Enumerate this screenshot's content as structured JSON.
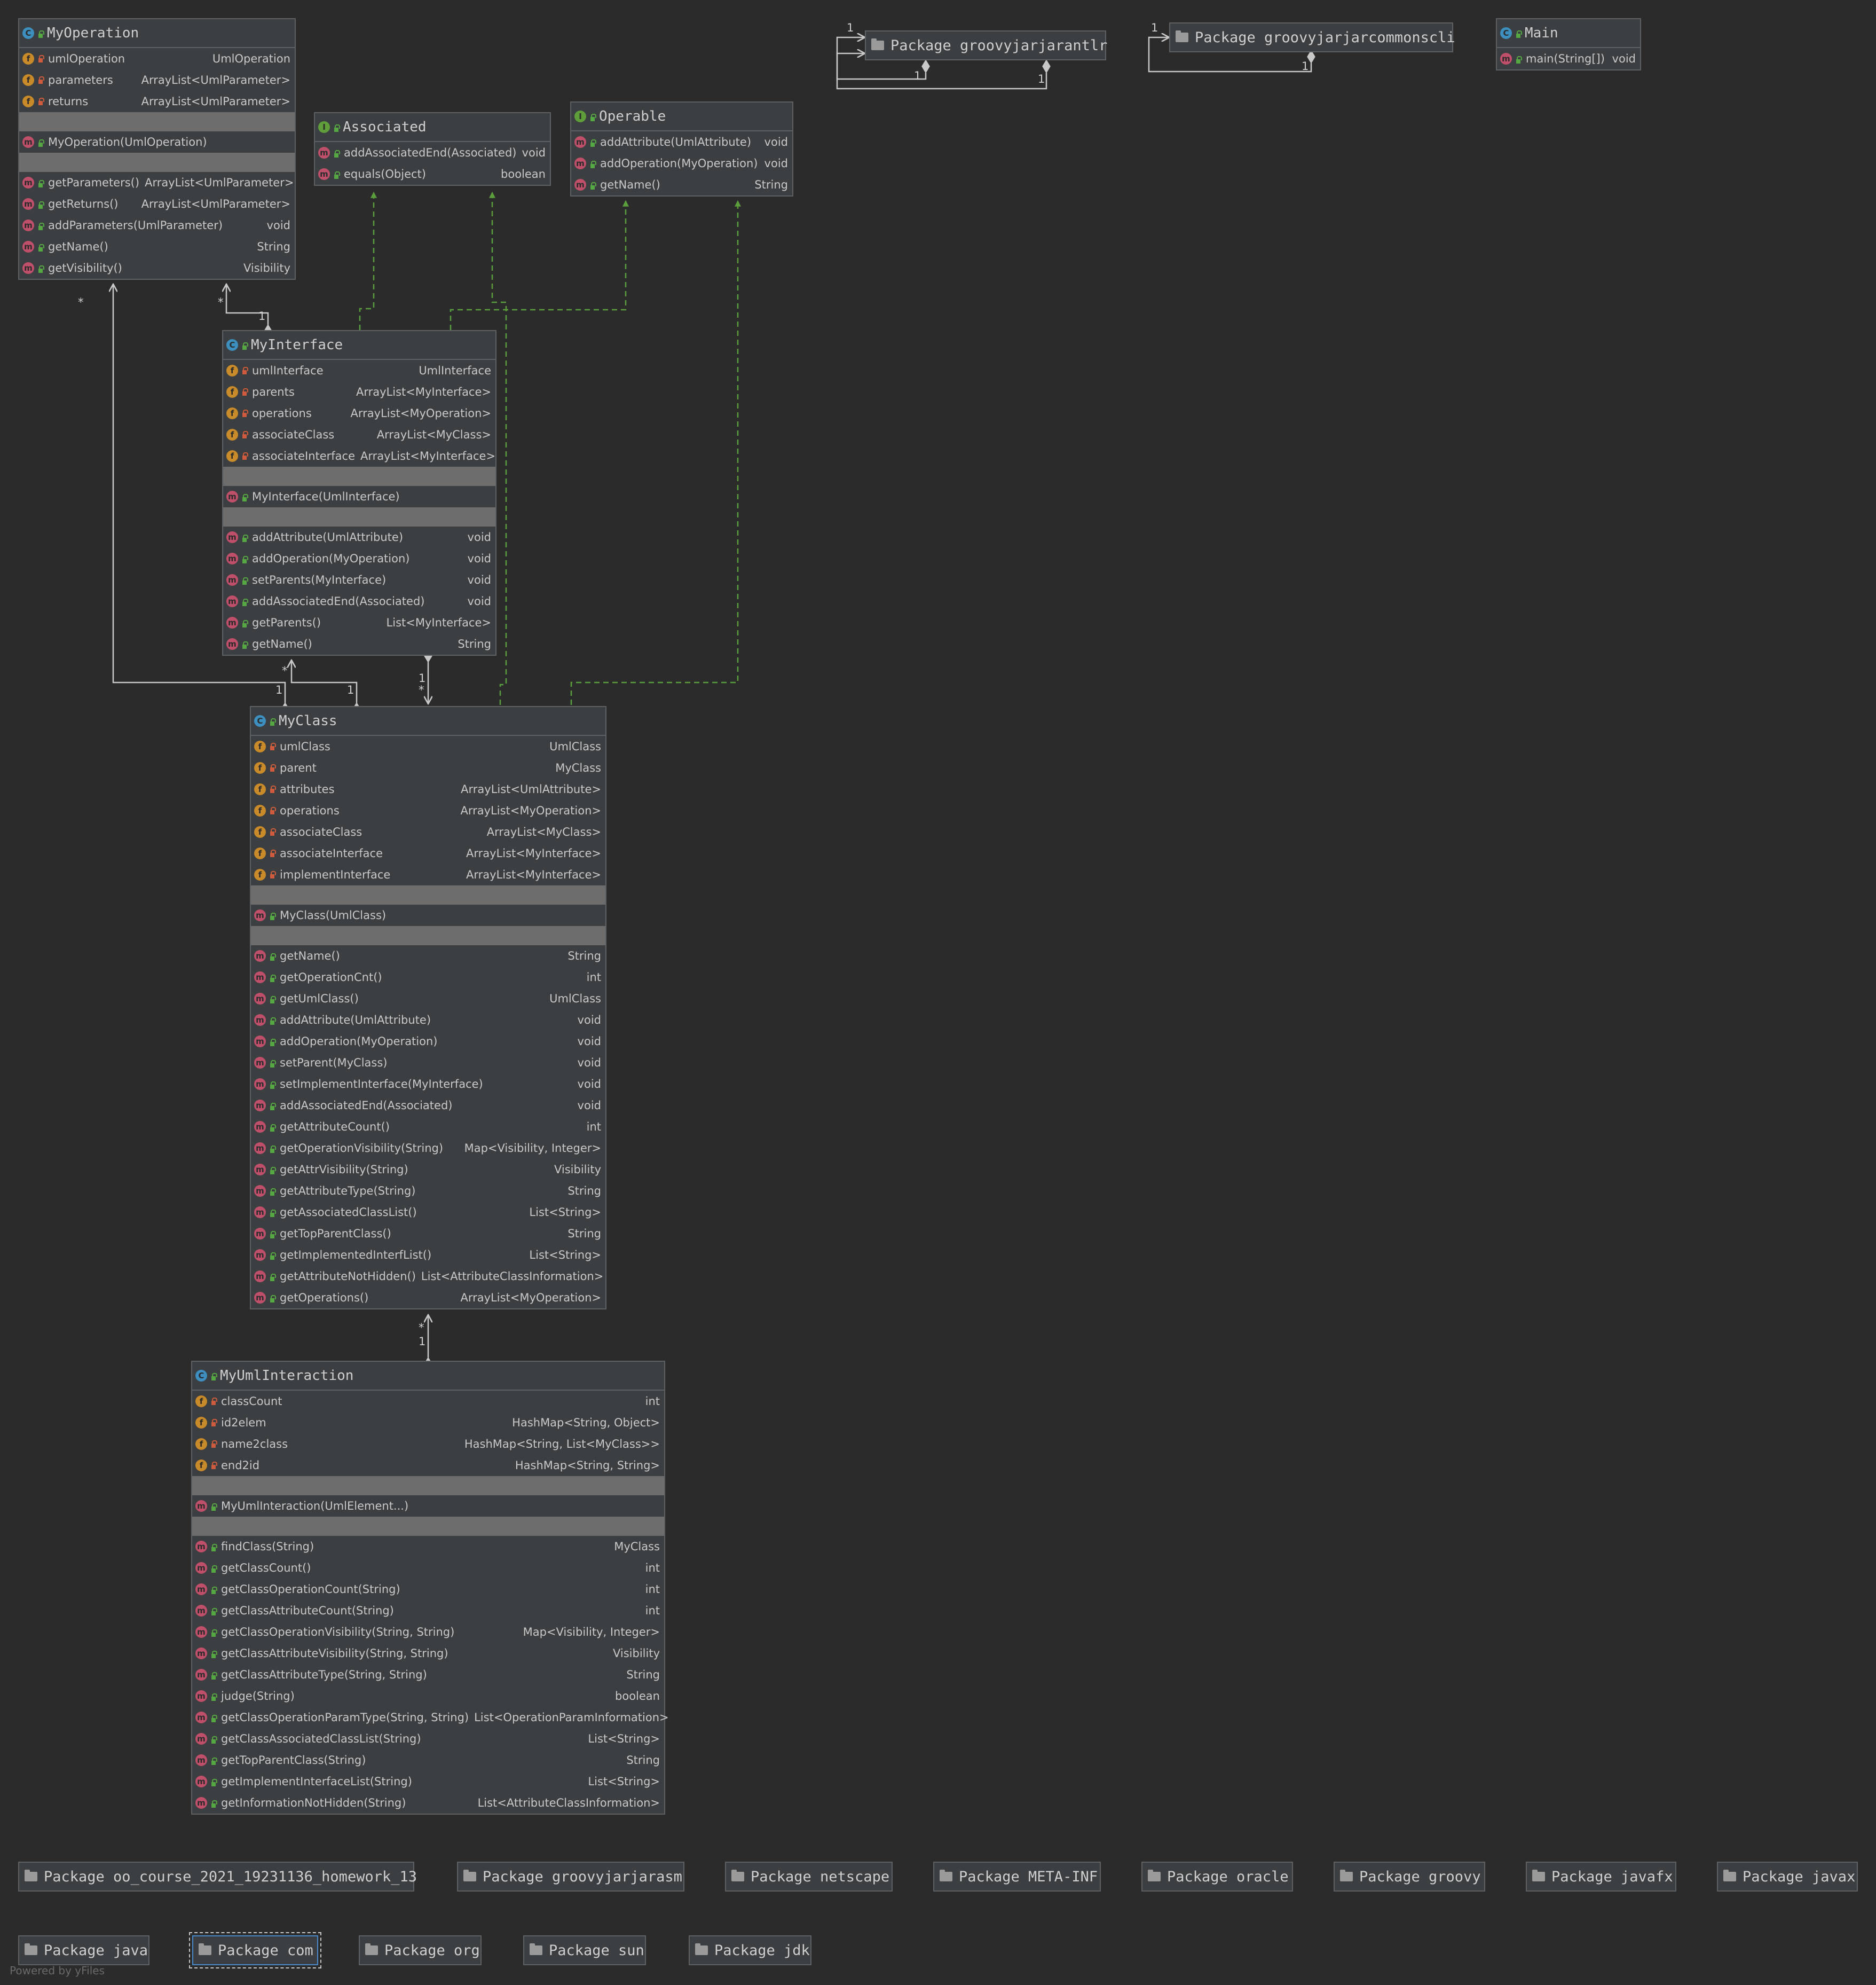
{
  "classes": {
    "myoperation": {
      "name": "MyOperation",
      "fields": [
        {
          "name": "umlOperation",
          "type": "UmlOperation"
        },
        {
          "name": "parameters",
          "type": "ArrayList<UmlParameter>"
        },
        {
          "name": "returns",
          "type": "ArrayList<UmlParameter>"
        }
      ],
      "constructors": [
        {
          "name": "MyOperation(UmlOperation)",
          "type": ""
        }
      ],
      "methods": [
        {
          "name": "getParameters()",
          "type": "ArrayList<UmlParameter>"
        },
        {
          "name": "getReturns()",
          "type": "ArrayList<UmlParameter>"
        },
        {
          "name": "addParameters(UmlParameter)",
          "type": "void"
        },
        {
          "name": "getName()",
          "type": "String"
        },
        {
          "name": "getVisibility()",
          "type": "Visibility"
        }
      ]
    },
    "associated": {
      "name": "Associated",
      "methods": [
        {
          "name": "addAssociatedEnd(Associated)",
          "type": "void"
        },
        {
          "name": "equals(Object)",
          "type": "boolean"
        }
      ]
    },
    "operable": {
      "name": "Operable",
      "methods": [
        {
          "name": "addAttribute(UmlAttribute)",
          "type": "void"
        },
        {
          "name": "addOperation(MyOperation)",
          "type": "void"
        },
        {
          "name": "getName()",
          "type": "String"
        }
      ]
    },
    "main": {
      "name": "Main",
      "methods": [
        {
          "name": "main(String[])",
          "type": "void"
        }
      ]
    },
    "myinterface": {
      "name": "MyInterface",
      "fields": [
        {
          "name": "umlInterface",
          "type": "UmlInterface"
        },
        {
          "name": "parents",
          "type": "ArrayList<MyInterface>"
        },
        {
          "name": "operations",
          "type": "ArrayList<MyOperation>"
        },
        {
          "name": "associateClass",
          "type": "ArrayList<MyClass>"
        },
        {
          "name": "associateInterface",
          "type": "ArrayList<MyInterface>"
        }
      ],
      "constructors": [
        {
          "name": "MyInterface(UmlInterface)",
          "type": ""
        }
      ],
      "methods": [
        {
          "name": "addAttribute(UmlAttribute)",
          "type": "void"
        },
        {
          "name": "addOperation(MyOperation)",
          "type": "void"
        },
        {
          "name": "setParents(MyInterface)",
          "type": "void"
        },
        {
          "name": "addAssociatedEnd(Associated)",
          "type": "void"
        },
        {
          "name": "getParents()",
          "type": "List<MyInterface>"
        },
        {
          "name": "getName()",
          "type": "String"
        }
      ]
    },
    "myclass": {
      "name": "MyClass",
      "fields": [
        {
          "name": "umlClass",
          "type": "UmlClass"
        },
        {
          "name": "parent",
          "type": "MyClass"
        },
        {
          "name": "attributes",
          "type": "ArrayList<UmlAttribute>"
        },
        {
          "name": "operations",
          "type": "ArrayList<MyOperation>"
        },
        {
          "name": "associateClass",
          "type": "ArrayList<MyClass>"
        },
        {
          "name": "associateInterface",
          "type": "ArrayList<MyInterface>"
        },
        {
          "name": "implementInterface",
          "type": "ArrayList<MyInterface>"
        }
      ],
      "constructors": [
        {
          "name": "MyClass(UmlClass)",
          "type": ""
        }
      ],
      "methods": [
        {
          "name": "getName()",
          "type": "String"
        },
        {
          "name": "getOperationCnt()",
          "type": "int"
        },
        {
          "name": "getUmlClass()",
          "type": "UmlClass"
        },
        {
          "name": "addAttribute(UmlAttribute)",
          "type": "void"
        },
        {
          "name": "addOperation(MyOperation)",
          "type": "void"
        },
        {
          "name": "setParent(MyClass)",
          "type": "void"
        },
        {
          "name": "setImplementInterface(MyInterface)",
          "type": "void"
        },
        {
          "name": "addAssociatedEnd(Associated)",
          "type": "void"
        },
        {
          "name": "getAttributeCount()",
          "type": "int"
        },
        {
          "name": "getOperationVisibility(String)",
          "type": "Map<Visibility, Integer>"
        },
        {
          "name": "getAttrVisibility(String)",
          "type": "Visibility"
        },
        {
          "name": "getAttributeType(String)",
          "type": "String"
        },
        {
          "name": "getAssociatedClassList()",
          "type": "List<String>"
        },
        {
          "name": "getTopParentClass()",
          "type": "String"
        },
        {
          "name": "getImplementedInterfList()",
          "type": "List<String>"
        },
        {
          "name": "getAttributeNotHidden()",
          "type": "List<AttributeClassInformation>"
        },
        {
          "name": "getOperations()",
          "type": "ArrayList<MyOperation>"
        }
      ]
    },
    "myumlinteraction": {
      "name": "MyUmlInteraction",
      "fields": [
        {
          "name": "classCount",
          "type": "int"
        },
        {
          "name": "id2elem",
          "type": "HashMap<String, Object>"
        },
        {
          "name": "name2class",
          "type": "HashMap<String, List<MyClass>>"
        },
        {
          "name": "end2id",
          "type": "HashMap<String, String>"
        }
      ],
      "constructors": [
        {
          "name": "MyUmlInteraction(UmlElement...)",
          "type": ""
        }
      ],
      "methods": [
        {
          "name": "findClass(String)",
          "type": "MyClass"
        },
        {
          "name": "getClassCount()",
          "type": "int"
        },
        {
          "name": "getClassOperationCount(String)",
          "type": "int"
        },
        {
          "name": "getClassAttributeCount(String)",
          "type": "int"
        },
        {
          "name": "getClassOperationVisibility(String, String)",
          "type": "Map<Visibility, Integer>"
        },
        {
          "name": "getClassAttributeVisibility(String, String)",
          "type": "Visibility"
        },
        {
          "name": "getClassAttributeType(String, String)",
          "type": "String"
        },
        {
          "name": "judge(String)",
          "type": "boolean"
        },
        {
          "name": "getClassOperationParamType(String, String)",
          "type": "List<OperationParamInformation>"
        },
        {
          "name": "getClassAssociatedClassList(String)",
          "type": "List<String>"
        },
        {
          "name": "getTopParentClass(String)",
          "type": "String"
        },
        {
          "name": "getImplementInterfaceList(String)",
          "type": "List<String>"
        },
        {
          "name": "getInformationNotHidden(String)",
          "type": "List<AttributeClassInformation>"
        }
      ]
    }
  },
  "packages": {
    "antlr": "Package groovyjarjarantlr",
    "commonscli": "Package groovyjarjarcommonscli",
    "homework": "Package oo_course_2021_19231136_homework_13",
    "asm": "Package groovyjarjarasm",
    "netscape": "Package netscape",
    "metainf": "Package META-INF",
    "oracle": "Package oracle",
    "groovy": "Package groovy",
    "javafx": "Package javafx",
    "javax": "Package javax",
    "java": "Package java",
    "com": "Package com",
    "org": "Package org",
    "sun": "Package sun",
    "jdk": "Package jdk"
  },
  "multiplicity": {
    "one": "1",
    "many": "*"
  },
  "footer": "Powered by yFiles",
  "colors": {
    "background": "#2b2b2b",
    "node": "#3c3f41",
    "separator": "#6d6d6d",
    "realization": "#5a9e3c",
    "association": "#c8c8c8"
  }
}
